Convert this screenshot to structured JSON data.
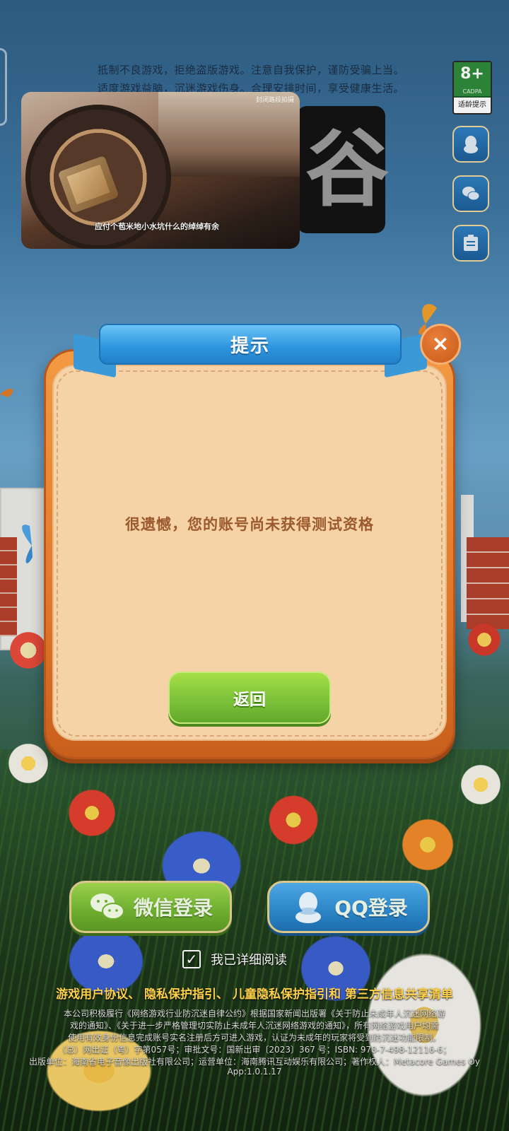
{
  "warning": {
    "line1": "抵制不良游戏，拒绝盗版游戏。注意自我保护，谨防受骗上当。",
    "line2": "适度游戏益脑，沉迷游戏伤身。合理安排时间，享受健康生活。"
  },
  "age_rating": {
    "age": "8+",
    "org": "CADPA",
    "label": "适龄提示"
  },
  "side_buttons": [
    "qq-icon",
    "wechat-icon",
    "notice-icon"
  ],
  "video_overlay": {
    "corner_text": "封闭路段拍摄",
    "caption": "应付个苞米地小水坑什么的绰绰有余"
  },
  "dialog": {
    "title": "提示",
    "close_symbol": "×",
    "message": "很遗憾，您的账号尚未获得测试资格",
    "back_label": "返回"
  },
  "login": {
    "wechat_label": "微信登录",
    "qq_label": "QQ登录"
  },
  "agreement": {
    "checked": true,
    "check_symbol": "✓",
    "text": "我已详细阅读"
  },
  "policies": {
    "user_agreement": "游戏用户协议",
    "sep1": "、",
    "privacy": "隐私保护指引",
    "sep2": "、",
    "child_privacy": "儿童隐私保护指引和",
    "third_party": "第三方信息共享清单"
  },
  "legal": {
    "line1": "本公司积极履行《网络游戏行业防沉迷自律公约》根据国家新闻出版署《关于防止未成年人沉迷网络游",
    "line2": "戏的通知》、《关于进一步严格管理切实防止未成年人沉迷网络游戏的通知》，所有网络游戏用户均需",
    "line3": "使用有效身份信息完成账号实名注册后方可进入游戏，认证为未成年的玩家将受到防沉迷功能限制。",
    "line4": "（总）网出证（粤）字第057号；审批文号：国新出审〔2023〕367 号；ISBN: 978-7-498-12116-6；",
    "line5": "出版单位：海南省电子音像出版社有限公司；运营单位：海南腾讯互动娱乐有限公司；著作权人：Metacore Games Oy"
  },
  "app_version": "App:1.0.1.17",
  "colors": {
    "dialog_orange": "#e1782a",
    "ribbon_blue": "#2f97e0",
    "back_green": "#7cc23a",
    "policy_yellow": "#ffd04a"
  }
}
